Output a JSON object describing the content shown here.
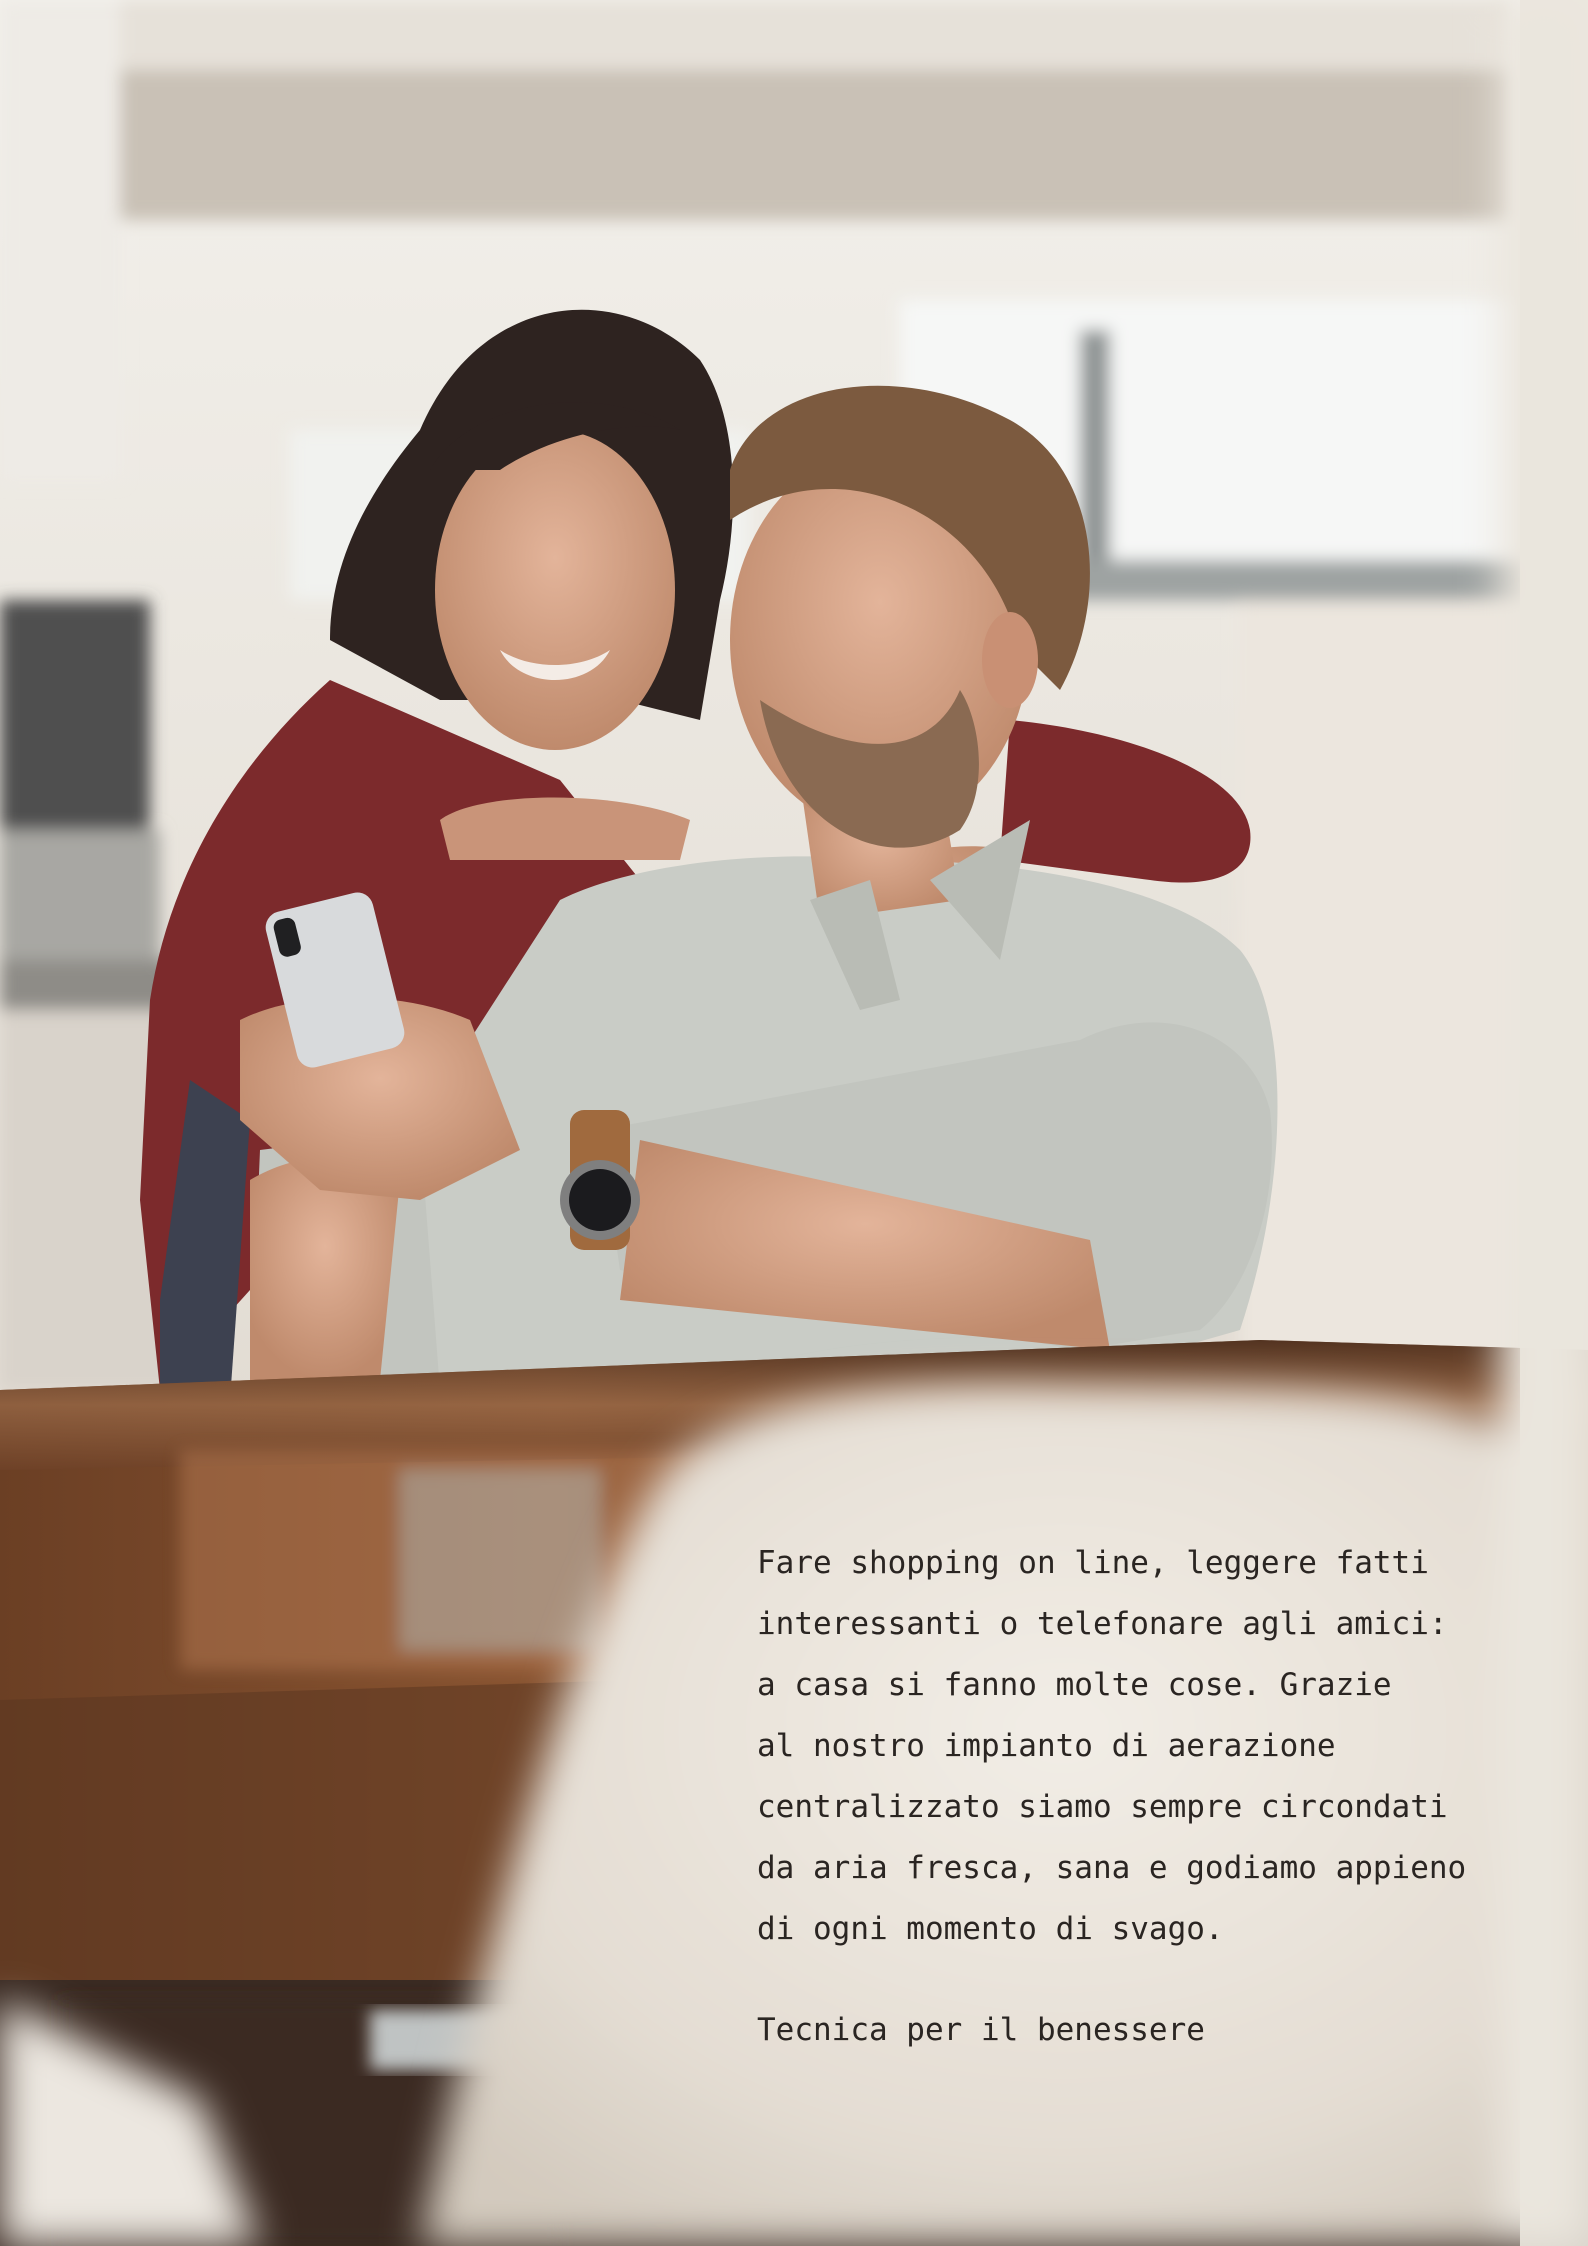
{
  "body_text": {
    "lines": [
      "Fare shopping on line, leggere fatti",
      "interessanti o telefonare agli amici:",
      "a casa si fanno molte cose. Grazie",
      "al nostro impianto di aerazione",
      "centralizzato siamo sempre circondati",
      "da aria fresca, sana e godiamo appieno",
      "di ogni momento di svago."
    ]
  },
  "tagline": "Tecnica per il benessere",
  "colors": {
    "text": "#2a2522",
    "background": "#e9e4dd",
    "shirt_woman": "#7c2a2c",
    "shirt_man": "#c9ccc6",
    "table_wood": "#7a4a2c"
  },
  "icons": {
    "photo": "couple-with-smartphone-photo"
  }
}
